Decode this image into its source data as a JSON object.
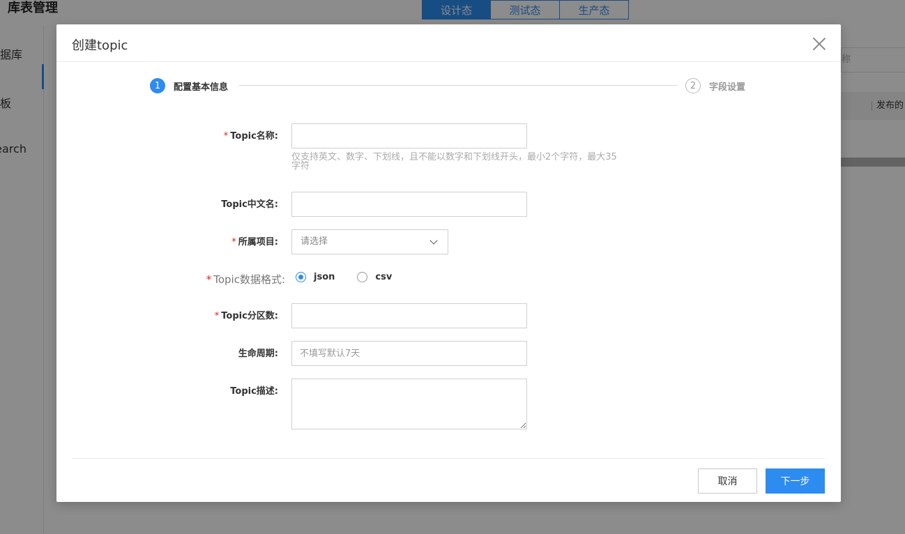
{
  "app": {
    "title": "库表管理",
    "env_tabs": [
      "设计态",
      "测试态",
      "生产态"
    ],
    "sidebar_items": [
      "数据库",
      "看板",
      "Search"
    ],
    "search_placeholder": "称",
    "table_header_text": "发布的"
  },
  "modal": {
    "title": "创建topic",
    "steps": [
      {
        "number": "1",
        "label": "配置基本信息",
        "state": "active"
      },
      {
        "number": "2",
        "label": "字段设置",
        "state": "pending"
      }
    ],
    "fields": {
      "topic_name": {
        "label": "Topic名称:",
        "required": true,
        "value": "",
        "hint": "仅支持英文、数字、下划线，且不能以数字和下划线开头，最小2个字符，最大35字符"
      },
      "topic_cn_name": {
        "label": "Topic中文名:",
        "required": false,
        "value": ""
      },
      "project": {
        "label": "所属项目:",
        "required": true,
        "placeholder": "请选择"
      },
      "data_format": {
        "label": "Topic数据格式:",
        "required": true,
        "options": [
          "json",
          "csv"
        ],
        "selected": "json"
      },
      "partitions": {
        "label": "Topic分区数:",
        "required": true,
        "value": ""
      },
      "lifecycle": {
        "label": "生命周期:",
        "required": false,
        "placeholder": "不填写默认7天"
      },
      "description": {
        "label": "Topic描述:",
        "required": false,
        "value": ""
      }
    },
    "buttons": {
      "cancel": "取消",
      "next": "下一步"
    }
  },
  "colors": {
    "accent": "#2d8cf0",
    "required": "#e02020",
    "overlay": "rgba(0,0,0,0.45)"
  }
}
